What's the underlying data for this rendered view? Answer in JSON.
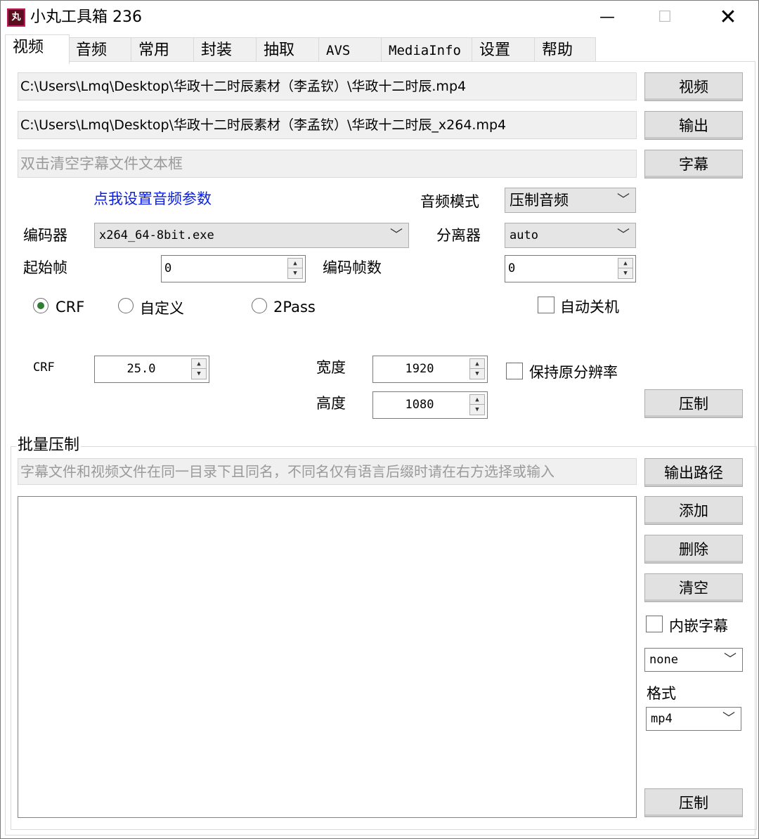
{
  "window": {
    "icon_glyph": "丸",
    "title": "小丸工具箱 236",
    "minimize_glyph": "—",
    "maximize_glyph": "☐",
    "close_glyph": "✕"
  },
  "tabs": [
    "视频",
    "音频",
    "常用",
    "封装",
    "抽取",
    "AVS",
    "MediaInfo",
    "设置",
    "帮助"
  ],
  "video": {
    "input_path": "C:\\Users\\Lmq\\Desktop\\华政十二时辰素材（李孟钦）\\华政十二时辰.mp4",
    "video_button": "视频",
    "output_path": "C:\\Users\\Lmq\\Desktop\\华政十二时辰素材（李孟钦）\\华政十二时辰_x264.mp4",
    "output_button": "输出",
    "subtitle_placeholder": "双击清空字幕文件文本框",
    "subtitle_button": "字幕",
    "audio_settings_link": "点我设置音频参数",
    "audio_mode_label": "音频模式",
    "audio_mode_value": "压制音频",
    "encoder_label": "编码器",
    "encoder_value": "x264_64-8bit.exe",
    "splitter_label": "分离器",
    "splitter_value": "auto",
    "start_frame_label": "起始帧",
    "start_frame_value": "0",
    "encode_frames_label": "编码帧数",
    "encode_frames_value": "0",
    "mode_crf": "CRF",
    "mode_custom": "自定义",
    "mode_2pass": "2Pass",
    "auto_shutdown": "自动关机",
    "crf_label": "CRF",
    "crf_value": "25.0",
    "width_label": "宽度",
    "width_value": "1920",
    "height_label": "高度",
    "height_value": "1080",
    "keep_resolution": "保持原分辨率",
    "encode_button": "压制"
  },
  "batch": {
    "group_title": "批量压制",
    "hint_placeholder": "字幕文件和视频文件在同一目录下且同名，不同名仅有语言后缀时请在右方选择或输入",
    "output_path_button": "输出路径",
    "add_button": "添加",
    "delete_button": "删除",
    "clear_button": "清空",
    "embed_subtitle": "内嵌字幕",
    "subtitle_lang_value": "none",
    "format_label": "格式",
    "format_value": "mp4",
    "encode_button": "压制"
  },
  "colors": {
    "link": "#0a1ee6",
    "radio_checked": "#2e7d32",
    "icon_bg": "#5a0f1f"
  }
}
